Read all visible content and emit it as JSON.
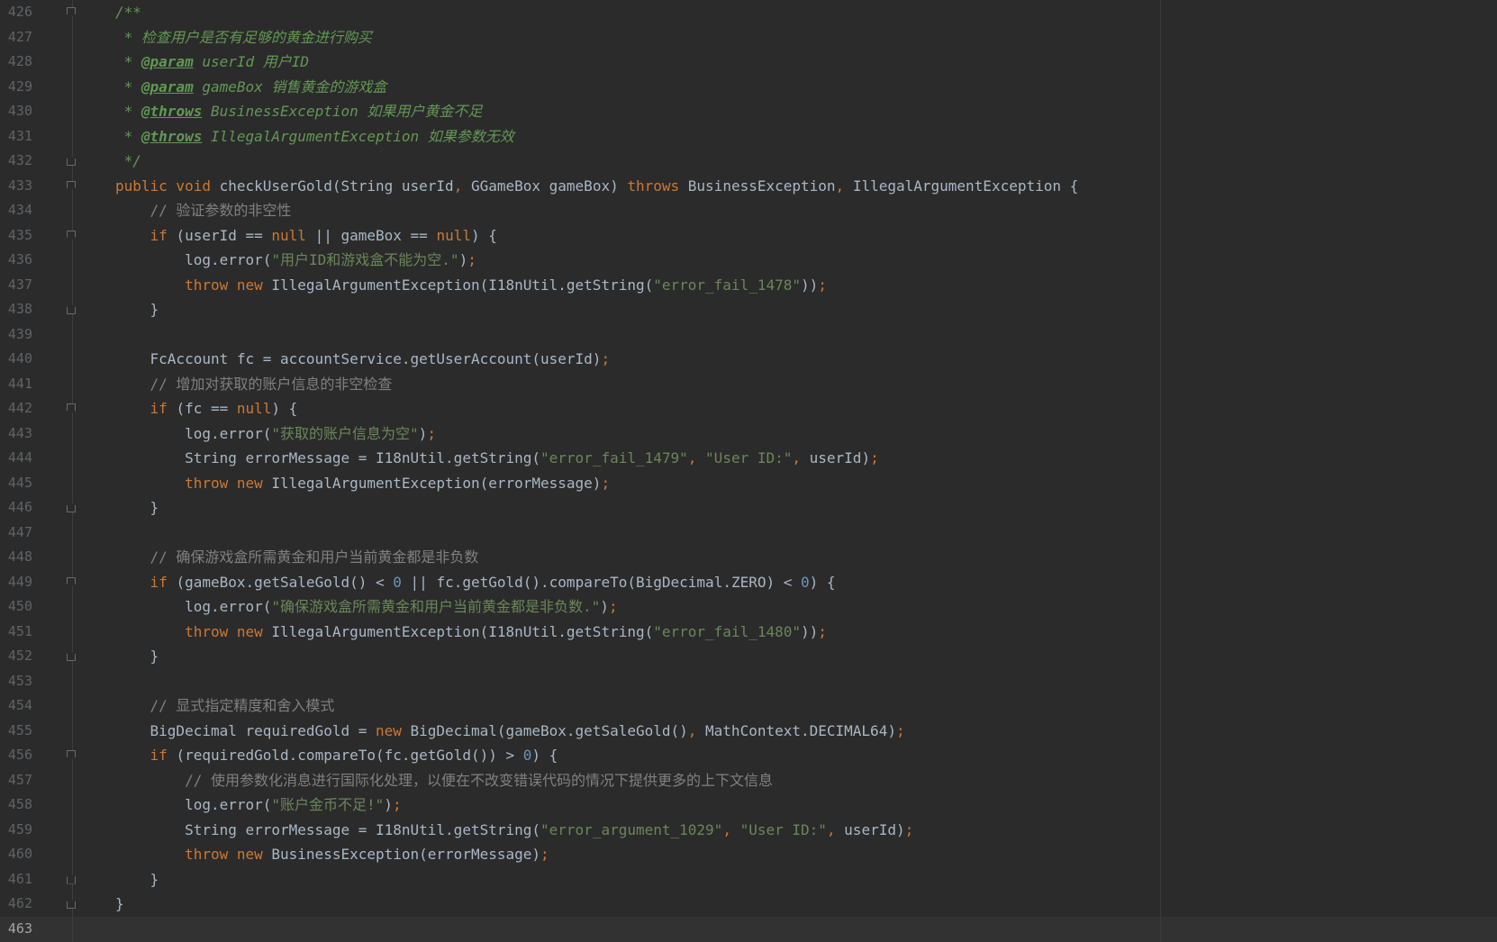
{
  "editor": {
    "current_line": "463",
    "lines": [
      {
        "n": "426",
        "segs": [
          [
            "doc",
            "/**"
          ]
        ]
      },
      {
        "n": "427",
        "segs": [
          [
            "doc",
            " * 检查用户是否有足够的黄金进行购买"
          ]
        ]
      },
      {
        "n": "428",
        "segs": [
          [
            "doc",
            " * "
          ],
          [
            "tag",
            "@param"
          ],
          [
            "doc",
            " userId 用户ID"
          ]
        ]
      },
      {
        "n": "429",
        "segs": [
          [
            "doc",
            " * "
          ],
          [
            "tag",
            "@param"
          ],
          [
            "doc",
            " gameBox 销售黄金的游戏盒"
          ]
        ]
      },
      {
        "n": "430",
        "segs": [
          [
            "doc",
            " * "
          ],
          [
            "tag",
            "@throws"
          ],
          [
            "doc",
            " BusinessException 如果用户黄金不足"
          ]
        ]
      },
      {
        "n": "431",
        "segs": [
          [
            "doc",
            " * "
          ],
          [
            "tag",
            "@throws"
          ],
          [
            "doc",
            " IllegalArgumentException 如果参数无效"
          ]
        ]
      },
      {
        "n": "432",
        "segs": [
          [
            "doc",
            " */"
          ]
        ]
      },
      {
        "n": "433",
        "segs": [
          [
            "kw",
            "public void "
          ],
          [
            "",
            "checkUserGold(String userId"
          ],
          [
            "kw",
            ", "
          ],
          [
            "",
            "GGameBox gameBox) "
          ],
          [
            "kw",
            "throws "
          ],
          [
            "",
            "BusinessException"
          ],
          [
            "kw",
            ", "
          ],
          [
            "",
            "IllegalArgumentException {"
          ]
        ]
      },
      {
        "n": "434",
        "segs": [
          [
            "cmt",
            "    // 验证参数的非空性"
          ]
        ]
      },
      {
        "n": "435",
        "segs": [
          [
            "kw",
            "    if "
          ],
          [
            "",
            "(userId == "
          ],
          [
            "kw",
            "null "
          ],
          [
            "",
            "|| gameBox == "
          ],
          [
            "kw",
            "null"
          ],
          [
            "",
            ") {"
          ]
        ]
      },
      {
        "n": "436",
        "segs": [
          [
            "",
            "        log.error("
          ],
          [
            "str",
            "\"用户ID和游戏盒不能为空.\""
          ],
          [
            "",
            ")"
          ],
          [
            "kw",
            ";"
          ]
        ]
      },
      {
        "n": "437",
        "segs": [
          [
            "kw",
            "        throw new "
          ],
          [
            "",
            "IllegalArgumentException(I18nUtil.getString("
          ],
          [
            "str",
            "\"error_fail_1478\""
          ],
          [
            "",
            "))"
          ],
          [
            "kw",
            ";"
          ]
        ]
      },
      {
        "n": "438",
        "segs": [
          [
            "",
            "    }"
          ]
        ]
      },
      {
        "n": "439",
        "segs": []
      },
      {
        "n": "440",
        "segs": [
          [
            "",
            "    FcAccount fc = accountService.getUserAccount(userId)"
          ],
          [
            "kw",
            ";"
          ]
        ]
      },
      {
        "n": "441",
        "segs": [
          [
            "cmt",
            "    // 增加对获取的账户信息的非空检查"
          ]
        ]
      },
      {
        "n": "442",
        "segs": [
          [
            "kw",
            "    if "
          ],
          [
            "",
            "(fc == "
          ],
          [
            "kw",
            "null"
          ],
          [
            "",
            ") {"
          ]
        ]
      },
      {
        "n": "443",
        "segs": [
          [
            "",
            "        log.error("
          ],
          [
            "str",
            "\"获取的账户信息为空\""
          ],
          [
            "",
            ")"
          ],
          [
            "kw",
            ";"
          ]
        ]
      },
      {
        "n": "444",
        "segs": [
          [
            "",
            "        String errorMessage = I18nUtil.getString("
          ],
          [
            "str",
            "\"error_fail_1479\""
          ],
          [
            "kw",
            ", "
          ],
          [
            "str",
            "\"User ID:\""
          ],
          [
            "kw",
            ", "
          ],
          [
            "",
            "userId)"
          ],
          [
            "kw",
            ";"
          ]
        ]
      },
      {
        "n": "445",
        "segs": [
          [
            "kw",
            "        throw new "
          ],
          [
            "",
            "IllegalArgumentException(errorMessage)"
          ],
          [
            "kw",
            ";"
          ]
        ]
      },
      {
        "n": "446",
        "segs": [
          [
            "",
            "    }"
          ]
        ]
      },
      {
        "n": "447",
        "segs": []
      },
      {
        "n": "448",
        "segs": [
          [
            "cmt",
            "    // 确保游戏盒所需黄金和用户当前黄金都是非负数"
          ]
        ]
      },
      {
        "n": "449",
        "segs": [
          [
            "kw",
            "    if "
          ],
          [
            "",
            "(gameBox.getSaleGold() < "
          ],
          [
            "num",
            "0"
          ],
          [
            "",
            " || fc.getGold().compareTo(BigDecimal.ZERO) < "
          ],
          [
            "num",
            "0"
          ],
          [
            "",
            ") {"
          ]
        ]
      },
      {
        "n": "450",
        "segs": [
          [
            "",
            "        log.error("
          ],
          [
            "str",
            "\"确保游戏盒所需黄金和用户当前黄金都是非负数.\""
          ],
          [
            "",
            ")"
          ],
          [
            "kw",
            ";"
          ]
        ]
      },
      {
        "n": "451",
        "segs": [
          [
            "kw",
            "        throw new "
          ],
          [
            "",
            "IllegalArgumentException(I18nUtil.getString("
          ],
          [
            "str",
            "\"error_fail_1480\""
          ],
          [
            "",
            "))"
          ],
          [
            "kw",
            ";"
          ]
        ]
      },
      {
        "n": "452",
        "segs": [
          [
            "",
            "    }"
          ]
        ]
      },
      {
        "n": "453",
        "segs": []
      },
      {
        "n": "454",
        "segs": [
          [
            "cmt",
            "    // 显式指定精度和舍入模式"
          ]
        ]
      },
      {
        "n": "455",
        "segs": [
          [
            "",
            "    BigDecimal requiredGold = "
          ],
          [
            "kw",
            "new "
          ],
          [
            "",
            "BigDecimal(gameBox.getSaleGold()"
          ],
          [
            "kw",
            ", "
          ],
          [
            "",
            "MathContext.DECIMAL64)"
          ],
          [
            "kw",
            ";"
          ]
        ]
      },
      {
        "n": "456",
        "segs": [
          [
            "kw",
            "    if "
          ],
          [
            "",
            "(requiredGold.compareTo(fc.getGold()) > "
          ],
          [
            "num",
            "0"
          ],
          [
            "",
            ") {"
          ]
        ]
      },
      {
        "n": "457",
        "segs": [
          [
            "cmt",
            "        // 使用参数化消息进行国际化处理，以便在不改变错误代码的情况下提供更多的上下文信息"
          ]
        ]
      },
      {
        "n": "458",
        "segs": [
          [
            "",
            "        log.error("
          ],
          [
            "str",
            "\"账户金币不足!\""
          ],
          [
            "",
            ")"
          ],
          [
            "kw",
            ";"
          ]
        ]
      },
      {
        "n": "459",
        "segs": [
          [
            "",
            "        String errorMessage = I18nUtil.getString("
          ],
          [
            "str",
            "\"error_argument_1029\""
          ],
          [
            "kw",
            ", "
          ],
          [
            "str",
            "\"User ID:\""
          ],
          [
            "kw",
            ", "
          ],
          [
            "",
            "userId)"
          ],
          [
            "kw",
            ";"
          ]
        ]
      },
      {
        "n": "460",
        "segs": [
          [
            "kw",
            "        throw new "
          ],
          [
            "",
            "BusinessException(errorMessage)"
          ],
          [
            "kw",
            ";"
          ]
        ]
      },
      {
        "n": "461",
        "segs": [
          [
            "",
            "    }"
          ]
        ]
      },
      {
        "n": "462",
        "segs": [
          [
            "",
            "}"
          ]
        ]
      },
      {
        "n": "463",
        "segs": []
      }
    ]
  }
}
